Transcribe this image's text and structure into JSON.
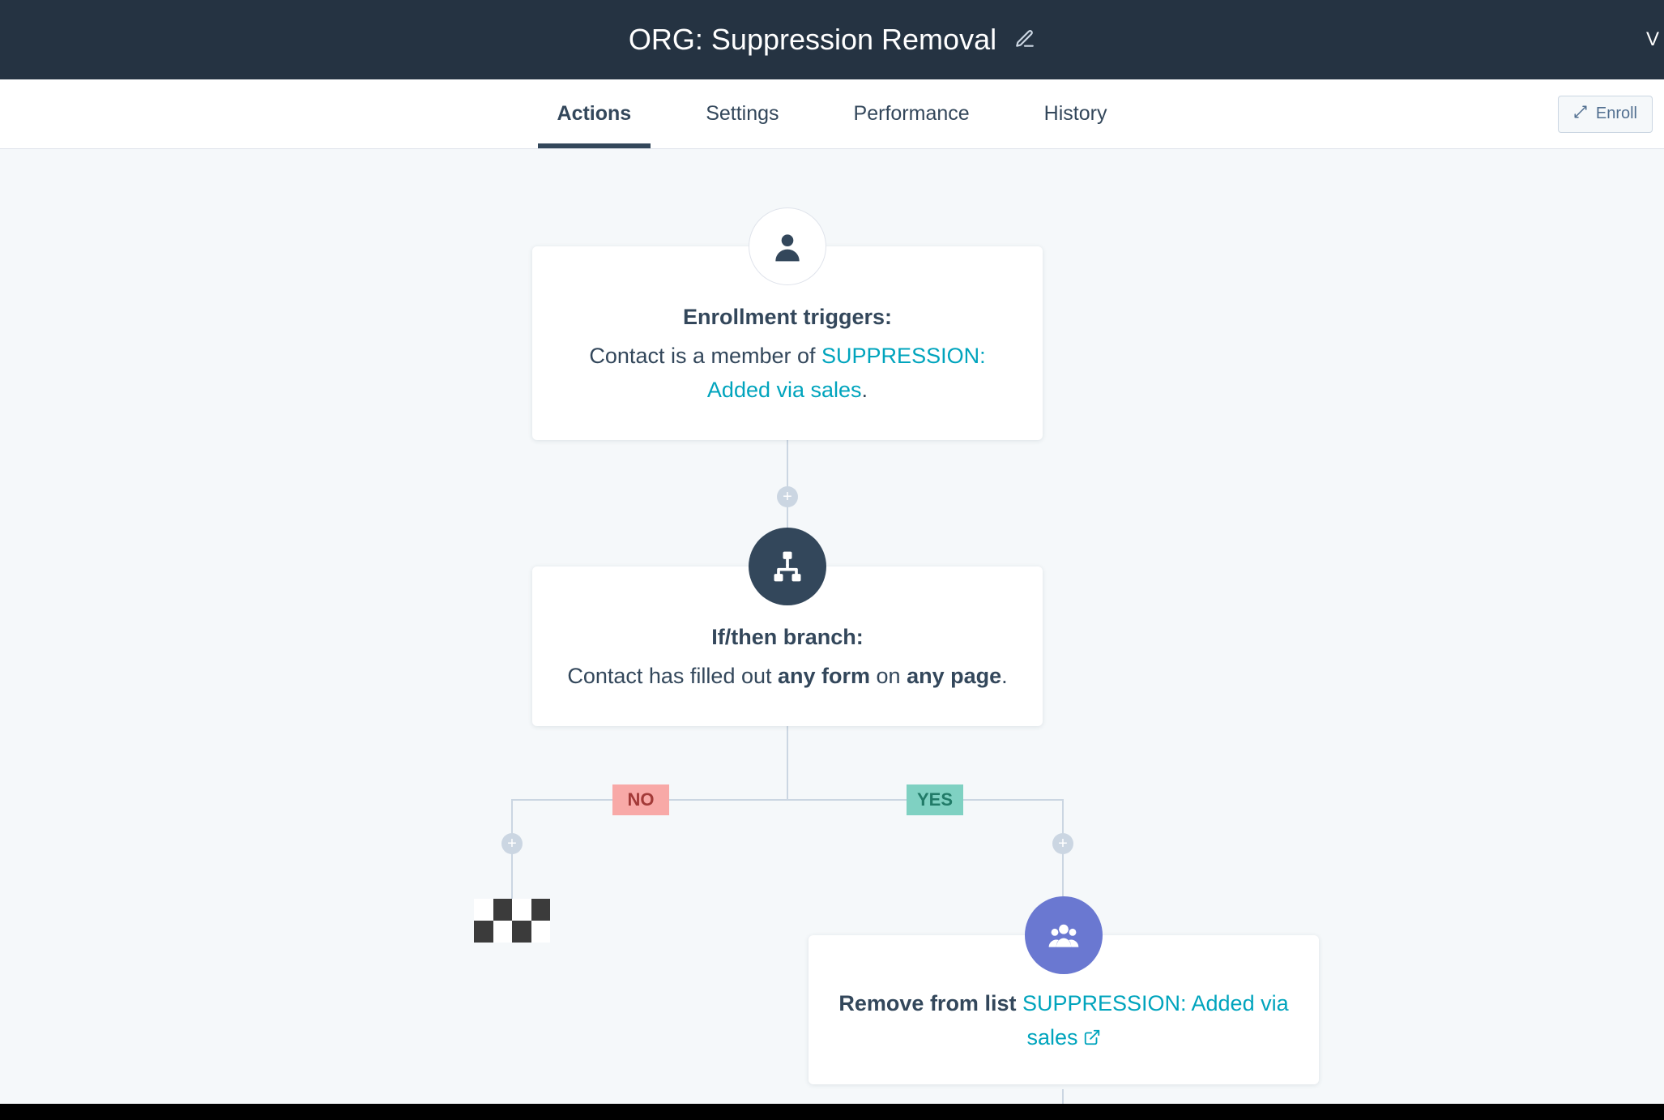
{
  "topbar": {
    "title": "ORG: Suppression Removal",
    "right_edge_text": "V"
  },
  "tabs": {
    "items": [
      {
        "label": "Actions",
        "active": true
      },
      {
        "label": "Settings",
        "active": false
      },
      {
        "label": "Performance",
        "active": false
      },
      {
        "label": "History",
        "active": false
      }
    ],
    "enroll_label": "Enroll"
  },
  "nodes": {
    "trigger": {
      "title": "Enrollment triggers:",
      "prefix": "Contact is a member of ",
      "link_text": "SUPPRESSION: Added via sales",
      "suffix": "."
    },
    "branch": {
      "title": "If/then branch:",
      "text_prefix": "Contact has filled out ",
      "bold1": "any form",
      "text_mid": " on ",
      "bold2": "any page",
      "suffix": ".",
      "no_label": "NO",
      "yes_label": "YES"
    },
    "action": {
      "title_prefix": "Remove from list ",
      "link_text": "SUPPRESSION: Added via sales"
    }
  }
}
